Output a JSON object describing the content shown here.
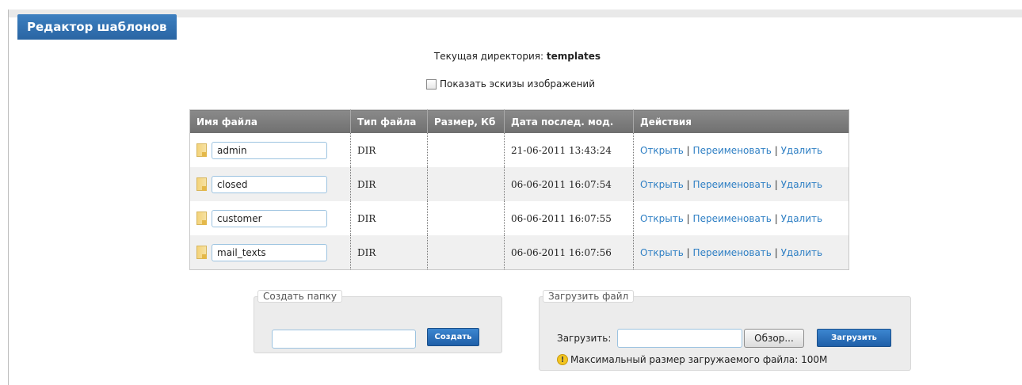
{
  "header": {
    "title": "Редактор шаблонов"
  },
  "current_dir": {
    "label": "Текущая директория:",
    "value": "templates"
  },
  "thumbs_option": {
    "label": "Показать эскизы изображений",
    "checked": false
  },
  "table": {
    "columns": [
      "Имя файла",
      "Тип файла",
      "Размер, Кб",
      "Дата послед. мод.",
      "Действия"
    ],
    "rows": [
      {
        "name": "admin",
        "type": "DIR",
        "size": "",
        "date": "21-06-2011 13:43:24"
      },
      {
        "name": "closed",
        "type": "DIR",
        "size": "",
        "date": "06-06-2011 16:07:54"
      },
      {
        "name": "customer",
        "type": "DIR",
        "size": "",
        "date": "06-06-2011 16:07:55"
      },
      {
        "name": "mail_texts",
        "type": "DIR",
        "size": "",
        "date": "06-06-2011 16:07:56"
      }
    ],
    "actions": {
      "open": "Открыть",
      "rename": "Переименовать",
      "delete": "Удалить",
      "separator": "|"
    }
  },
  "create_folder": {
    "legend": "Создать папку",
    "input_value": "",
    "button": "Создать"
  },
  "upload": {
    "legend": "Загрузить файл",
    "label": "Загрузить:",
    "file_value": "",
    "browse_button": "Обзор...",
    "upload_button": "Загрузить",
    "max_size_note": "Максимальный размер загружаемого файла: 100M"
  },
  "icons": {
    "folder": "folder-icon",
    "warning": "warning-icon"
  },
  "colors": {
    "accent": "#2a65a3",
    "header": "#777777",
    "link": "#2e7fc4"
  }
}
